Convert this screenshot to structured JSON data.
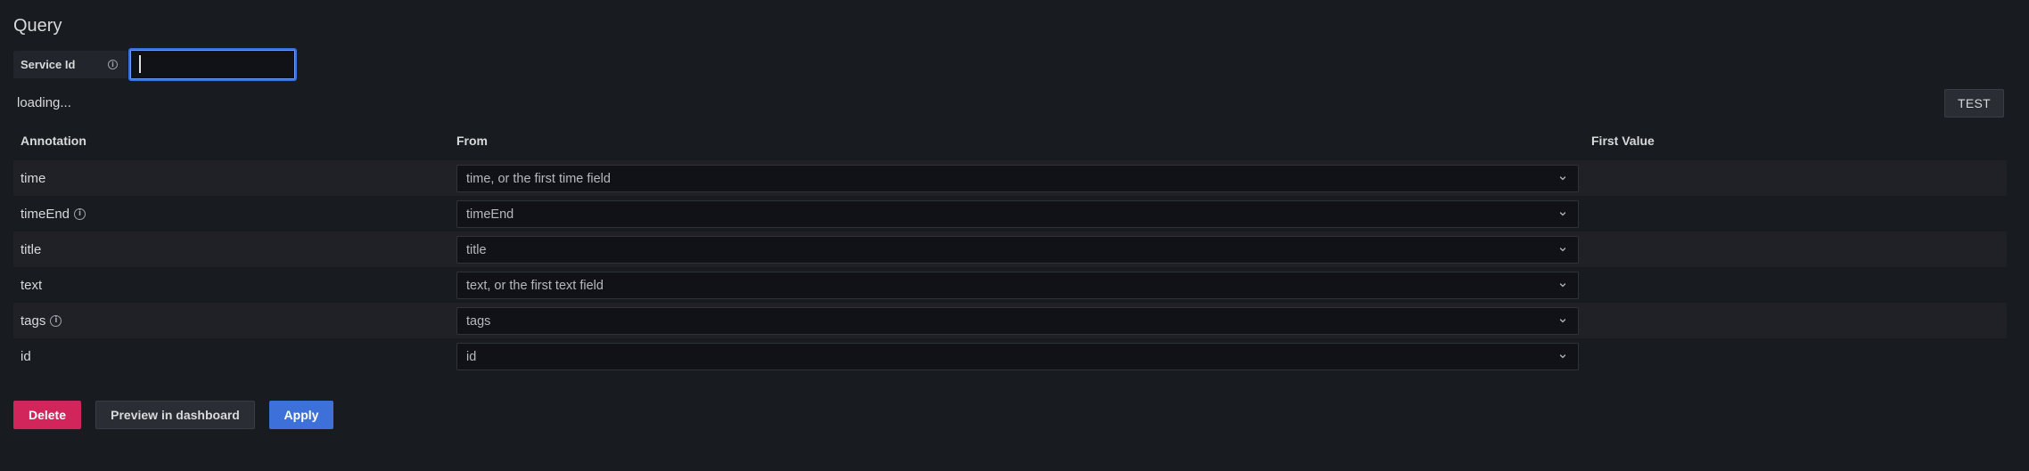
{
  "section_title": "Query",
  "query": {
    "service_id_label": "Service Id",
    "service_id_value": "",
    "service_id_placeholder": ""
  },
  "status": "loading...",
  "test_label": "TEST",
  "table": {
    "headers": [
      "Annotation",
      "From",
      "First Value"
    ],
    "rows": [
      {
        "label": "time",
        "has_info": false,
        "from": "time, or the first time field",
        "first_value": ""
      },
      {
        "label": "timeEnd",
        "has_info": true,
        "from": "timeEnd",
        "first_value": ""
      },
      {
        "label": "title",
        "has_info": false,
        "from": "title",
        "first_value": ""
      },
      {
        "label": "text",
        "has_info": false,
        "from": "text, or the first text field",
        "first_value": ""
      },
      {
        "label": "tags",
        "has_info": true,
        "from": "tags",
        "first_value": ""
      },
      {
        "label": "id",
        "has_info": false,
        "from": "id",
        "first_value": ""
      }
    ]
  },
  "buttons": {
    "delete": "Delete",
    "preview": "Preview in dashboard",
    "apply": "Apply"
  },
  "icons": {
    "info": "info-circle-icon",
    "chevron": "chevron-down-icon"
  },
  "colors": {
    "background": "#181b1f",
    "primary": "#3d71d9",
    "destructive": "#d1255b"
  }
}
